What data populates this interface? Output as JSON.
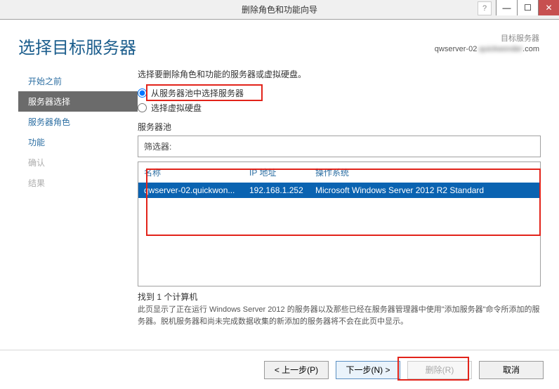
{
  "window": {
    "title": "删除角色和功能向导",
    "help_icon": "?"
  },
  "header": {
    "page_title": "选择目标服务器",
    "dest_label": "目标服务器",
    "dest_value_prefix": "qwserver-02",
    "dest_value_suffix": ".com"
  },
  "sidebar": {
    "steps": [
      {
        "label": "开始之前",
        "state": "done"
      },
      {
        "label": "服务器选择",
        "state": "current"
      },
      {
        "label": "服务器角色",
        "state": "done"
      },
      {
        "label": "功能",
        "state": "done"
      },
      {
        "label": "确认",
        "state": "disabled"
      },
      {
        "label": "结果",
        "state": "disabled"
      }
    ]
  },
  "main": {
    "prompt": "选择要删除角色和功能的服务器或虚拟硬盘。",
    "radio1": "从服务器池中选择服务器",
    "radio2": "选择虚拟硬盘",
    "pool_label": "服务器池",
    "filter_label": "筛选器:",
    "filter_value": "",
    "columns": {
      "name": "名称",
      "ip": "IP 地址",
      "os": "操作系统"
    },
    "rows": [
      {
        "name": "qwserver-02.quickwon...",
        "ip": "192.168.1.252",
        "os": "Microsoft Windows Server 2012 R2 Standard"
      }
    ],
    "found": "找到 1 个计算机",
    "desc": "此页显示了正在运行 Windows Server 2012 的服务器以及那些已经在服务器管理器中使用\"添加服务器\"命令所添加的服务器。脱机服务器和尚未完成数据收集的新添加的服务器将不会在此页中显示。"
  },
  "footer": {
    "prev": "< 上一步(P)",
    "next": "下一步(N) >",
    "remove": "删除(R)",
    "cancel": "取消"
  }
}
